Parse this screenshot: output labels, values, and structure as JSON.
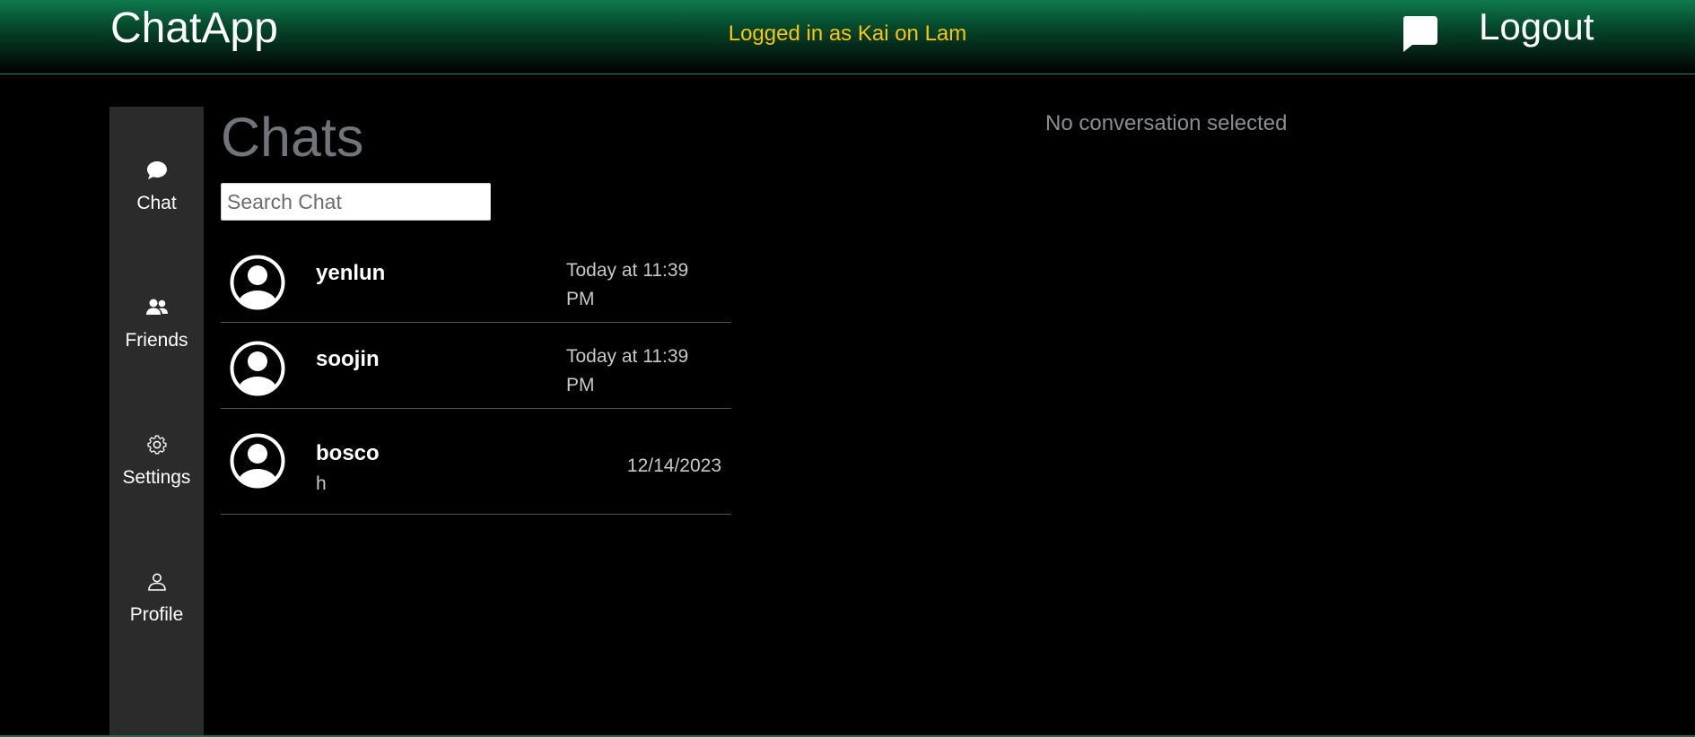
{
  "header": {
    "brand": "ChatApp",
    "logged_in_text": "Logged in as Kai on Lam",
    "logout_label": "Logout",
    "messages_icon": "speech-bubble-icon",
    "accent_color": "#f5c518",
    "gradient_color": "#0e7a4c"
  },
  "sidebar": {
    "items": [
      {
        "label": "Chat",
        "icon": "chat-bubble-icon"
      },
      {
        "label": "Friends",
        "icon": "users-icon"
      },
      {
        "label": "Settings",
        "icon": "gear-icon"
      },
      {
        "label": "Profile",
        "icon": "person-icon"
      }
    ]
  },
  "chats": {
    "title": "Chats",
    "search_placeholder": "Search Chat",
    "items": [
      {
        "name": "yenlun",
        "time": "Today at 11:39 PM",
        "preview": ""
      },
      {
        "name": "soojin",
        "time": "Today at 11:39 PM",
        "preview": ""
      },
      {
        "name": "bosco",
        "time": "12/14/2023",
        "preview": "h"
      }
    ]
  },
  "conversation": {
    "empty_text": "No conversation selected"
  }
}
